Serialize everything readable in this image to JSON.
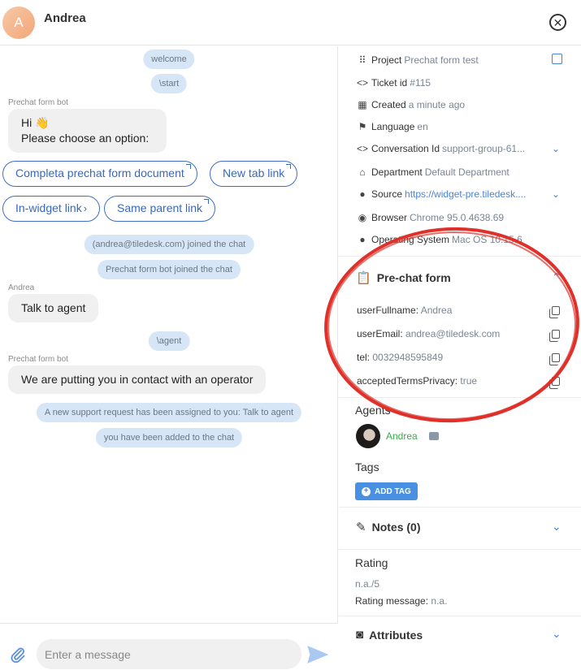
{
  "header": {
    "avatar_letter": "A",
    "name": "Andrea",
    "close_icon": "close-icon"
  },
  "messages": {
    "pill_welcome": "welcome",
    "pill_start": "\\start",
    "sender_bot_1": "Prechat form bot",
    "bubble_hi_line1": "Hi 👋",
    "bubble_hi_line2": "Please choose an option:",
    "options": {
      "completa": "Completa prechat form document",
      "new_tab": "New tab link",
      "in_widget": "In-widget link",
      "same_parent": "Same parent link"
    },
    "pill_joined_andrea": "(andrea@tiledesk.com) joined the chat",
    "pill_joined_bot": "Prechat form bot joined the chat",
    "sender_andrea": "Andrea",
    "bubble_talk": "Talk to agent",
    "pill_agent": "\\agent",
    "sender_bot_2": "Prechat form bot",
    "bubble_operator": "We are putting you in contact with an operator",
    "pill_assigned": "A new support request has been assigned to you: Talk to agent",
    "pill_added": "you have been added to the chat"
  },
  "composer": {
    "placeholder": "Enter a message"
  },
  "info": {
    "project": {
      "label": "Project",
      "value": "Prechat form test"
    },
    "ticket": {
      "label": "Ticket id",
      "value": "#115"
    },
    "created": {
      "label": "Created",
      "value": "a minute ago"
    },
    "language": {
      "label": "Language",
      "value": "en"
    },
    "conversation": {
      "label": "Conversation Id",
      "value": "support-group-61..."
    },
    "department": {
      "label": "Department",
      "value": "Default Department"
    },
    "source": {
      "label": "Source",
      "value": "https://widget-pre.tiledesk...."
    },
    "browser": {
      "label": "Browser",
      "value": "Chrome 95.0.4638.69"
    },
    "os": {
      "label": "Operating System",
      "value": "Mac OS 10.15.6"
    }
  },
  "prechat": {
    "title": "Pre-chat form",
    "fields": [
      {
        "key": "userFullname:",
        "value": "Andrea"
      },
      {
        "key": "userEmail:",
        "value": "andrea@tiledesk.com"
      },
      {
        "key": "tel:",
        "value": "0032948595849"
      },
      {
        "key": "acceptedTermsPrivacy:",
        "value": "true"
      }
    ]
  },
  "agents": {
    "title": "Agents",
    "name": "Andrea"
  },
  "tags": {
    "title": "Tags",
    "add_label": "ADD TAG"
  },
  "notes": {
    "title": "Notes (0)"
  },
  "rating": {
    "title": "Rating",
    "value": "n.a./5",
    "message_label": "Rating message:",
    "message_value": "n.a."
  },
  "attributes": {
    "title": "Attributes"
  },
  "colors": {
    "accent": "#4a84d8",
    "annotation": "#e0302a",
    "agent_online": "#3fa74a"
  }
}
